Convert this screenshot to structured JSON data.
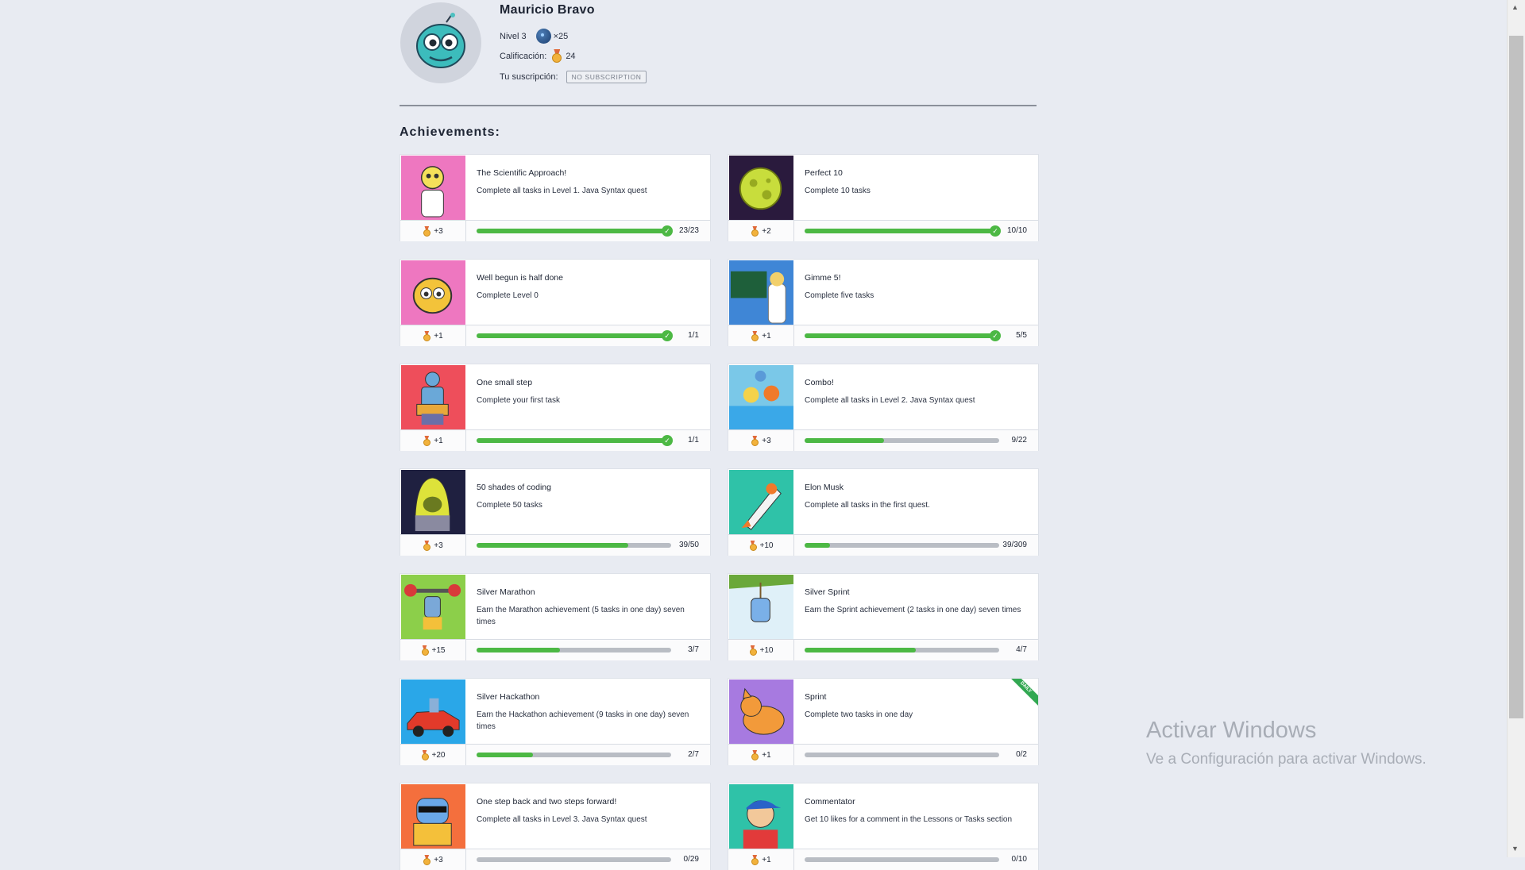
{
  "profile": {
    "name": "Mauricio Bravo",
    "level_label": "Nivel 3",
    "dark_matter": "×25",
    "rating_label": "Calificación:",
    "rating_value": "24",
    "subscription_label": "Tu suscripción:",
    "subscription_badge": "NO SUBSCRIPTION"
  },
  "section_title": "Achievements:",
  "achievements": [
    {
      "title": "The Scientific Approach!",
      "desc": "Complete all tasks in Level 1. Java Syntax quest",
      "points": "+3",
      "count": "23/23",
      "progress": 1.0,
      "done": true,
      "icon": "scientist-icon",
      "bg": "#ee77c0"
    },
    {
      "title": "Perfect 10",
      "desc": "Complete 10 tasks",
      "points": "+2",
      "count": "10/10",
      "progress": 1.0,
      "done": true,
      "icon": "planet-icon",
      "bg": "#2a1a3d"
    },
    {
      "title": "Well begun is half done",
      "desc": "Complete Level 0",
      "points": "+1",
      "count": "1/1",
      "progress": 1.0,
      "done": true,
      "icon": "robot-head-icon",
      "bg": "#ee77c0"
    },
    {
      "title": "Gimme 5!",
      "desc": "Complete five tasks",
      "points": "+1",
      "count": "5/5",
      "progress": 1.0,
      "done": true,
      "icon": "professor-icon",
      "bg": "#3f86d6"
    },
    {
      "title": "One small step",
      "desc": "Complete your first task",
      "points": "+1",
      "count": "1/1",
      "progress": 1.0,
      "done": true,
      "icon": "robot-laptop-icon",
      "bg": "#ee4e5b"
    },
    {
      "title": "Combo!",
      "desc": "Complete all tasks in Level 2. Java Syntax quest",
      "points": "+3",
      "count": "9/22",
      "progress": 0.41,
      "done": false,
      "icon": "pool-icon",
      "bg": "#7ac8e8"
    },
    {
      "title": "50 shades of coding",
      "desc": "Complete 50 tasks",
      "points": "+3",
      "count": "39/50",
      "progress": 0.78,
      "done": false,
      "icon": "hacker-icon",
      "bg": "#1f2040"
    },
    {
      "title": "Elon Musk",
      "desc": "Complete all tasks in the first quest.",
      "points": "+10",
      "count": "39/309",
      "progress": 0.13,
      "done": false,
      "icon": "rocket-icon",
      "bg": "#2fc2a8"
    },
    {
      "title": "Silver Marathon",
      "desc": "Earn the Marathon achievement (5 tasks in one day) seven times",
      "points": "+15",
      "count": "3/7",
      "progress": 0.43,
      "done": false,
      "icon": "weightlifter-icon",
      "bg": "#8ccf4a"
    },
    {
      "title": "Silver Sprint",
      "desc": "Earn the Sprint achievement (2 tasks in one day) seven times",
      "points": "+10",
      "count": "4/7",
      "progress": 0.57,
      "done": false,
      "icon": "jungle-robot-icon",
      "bg": "#dff0f8"
    },
    {
      "title": "Silver Hackathon",
      "desc": "Earn the Hackathon achievement (9 tasks in one day) seven times",
      "points": "+20",
      "count": "2/7",
      "progress": 0.29,
      "done": false,
      "icon": "race-car-icon",
      "bg": "#2aa7e8"
    },
    {
      "title": "Sprint",
      "desc": "Complete two tasks in one day",
      "points": "+1",
      "count": "0/2",
      "progress": 0.0,
      "done": false,
      "icon": "cat-icon",
      "bg": "#a77ae0",
      "ribbon": "DAILY"
    },
    {
      "title": "One step back and two steps forward!",
      "desc": "Complete all tasks in Level 3. Java Syntax quest",
      "points": "+3",
      "count": "0/29",
      "progress": 0.0,
      "done": false,
      "icon": "cool-robot-icon",
      "bg": "#f46f3d"
    },
    {
      "title": "Commentator",
      "desc": "Get 10 likes for a comment in the Lessons or Tasks section",
      "points": "+1",
      "count": "0/10",
      "progress": 0.0,
      "done": false,
      "icon": "guy-cap-icon",
      "bg": "#2fc2a8"
    }
  ],
  "watermark": {
    "title": "Activar Windows",
    "subtitle": "Ve a Configuración para activar Windows."
  }
}
